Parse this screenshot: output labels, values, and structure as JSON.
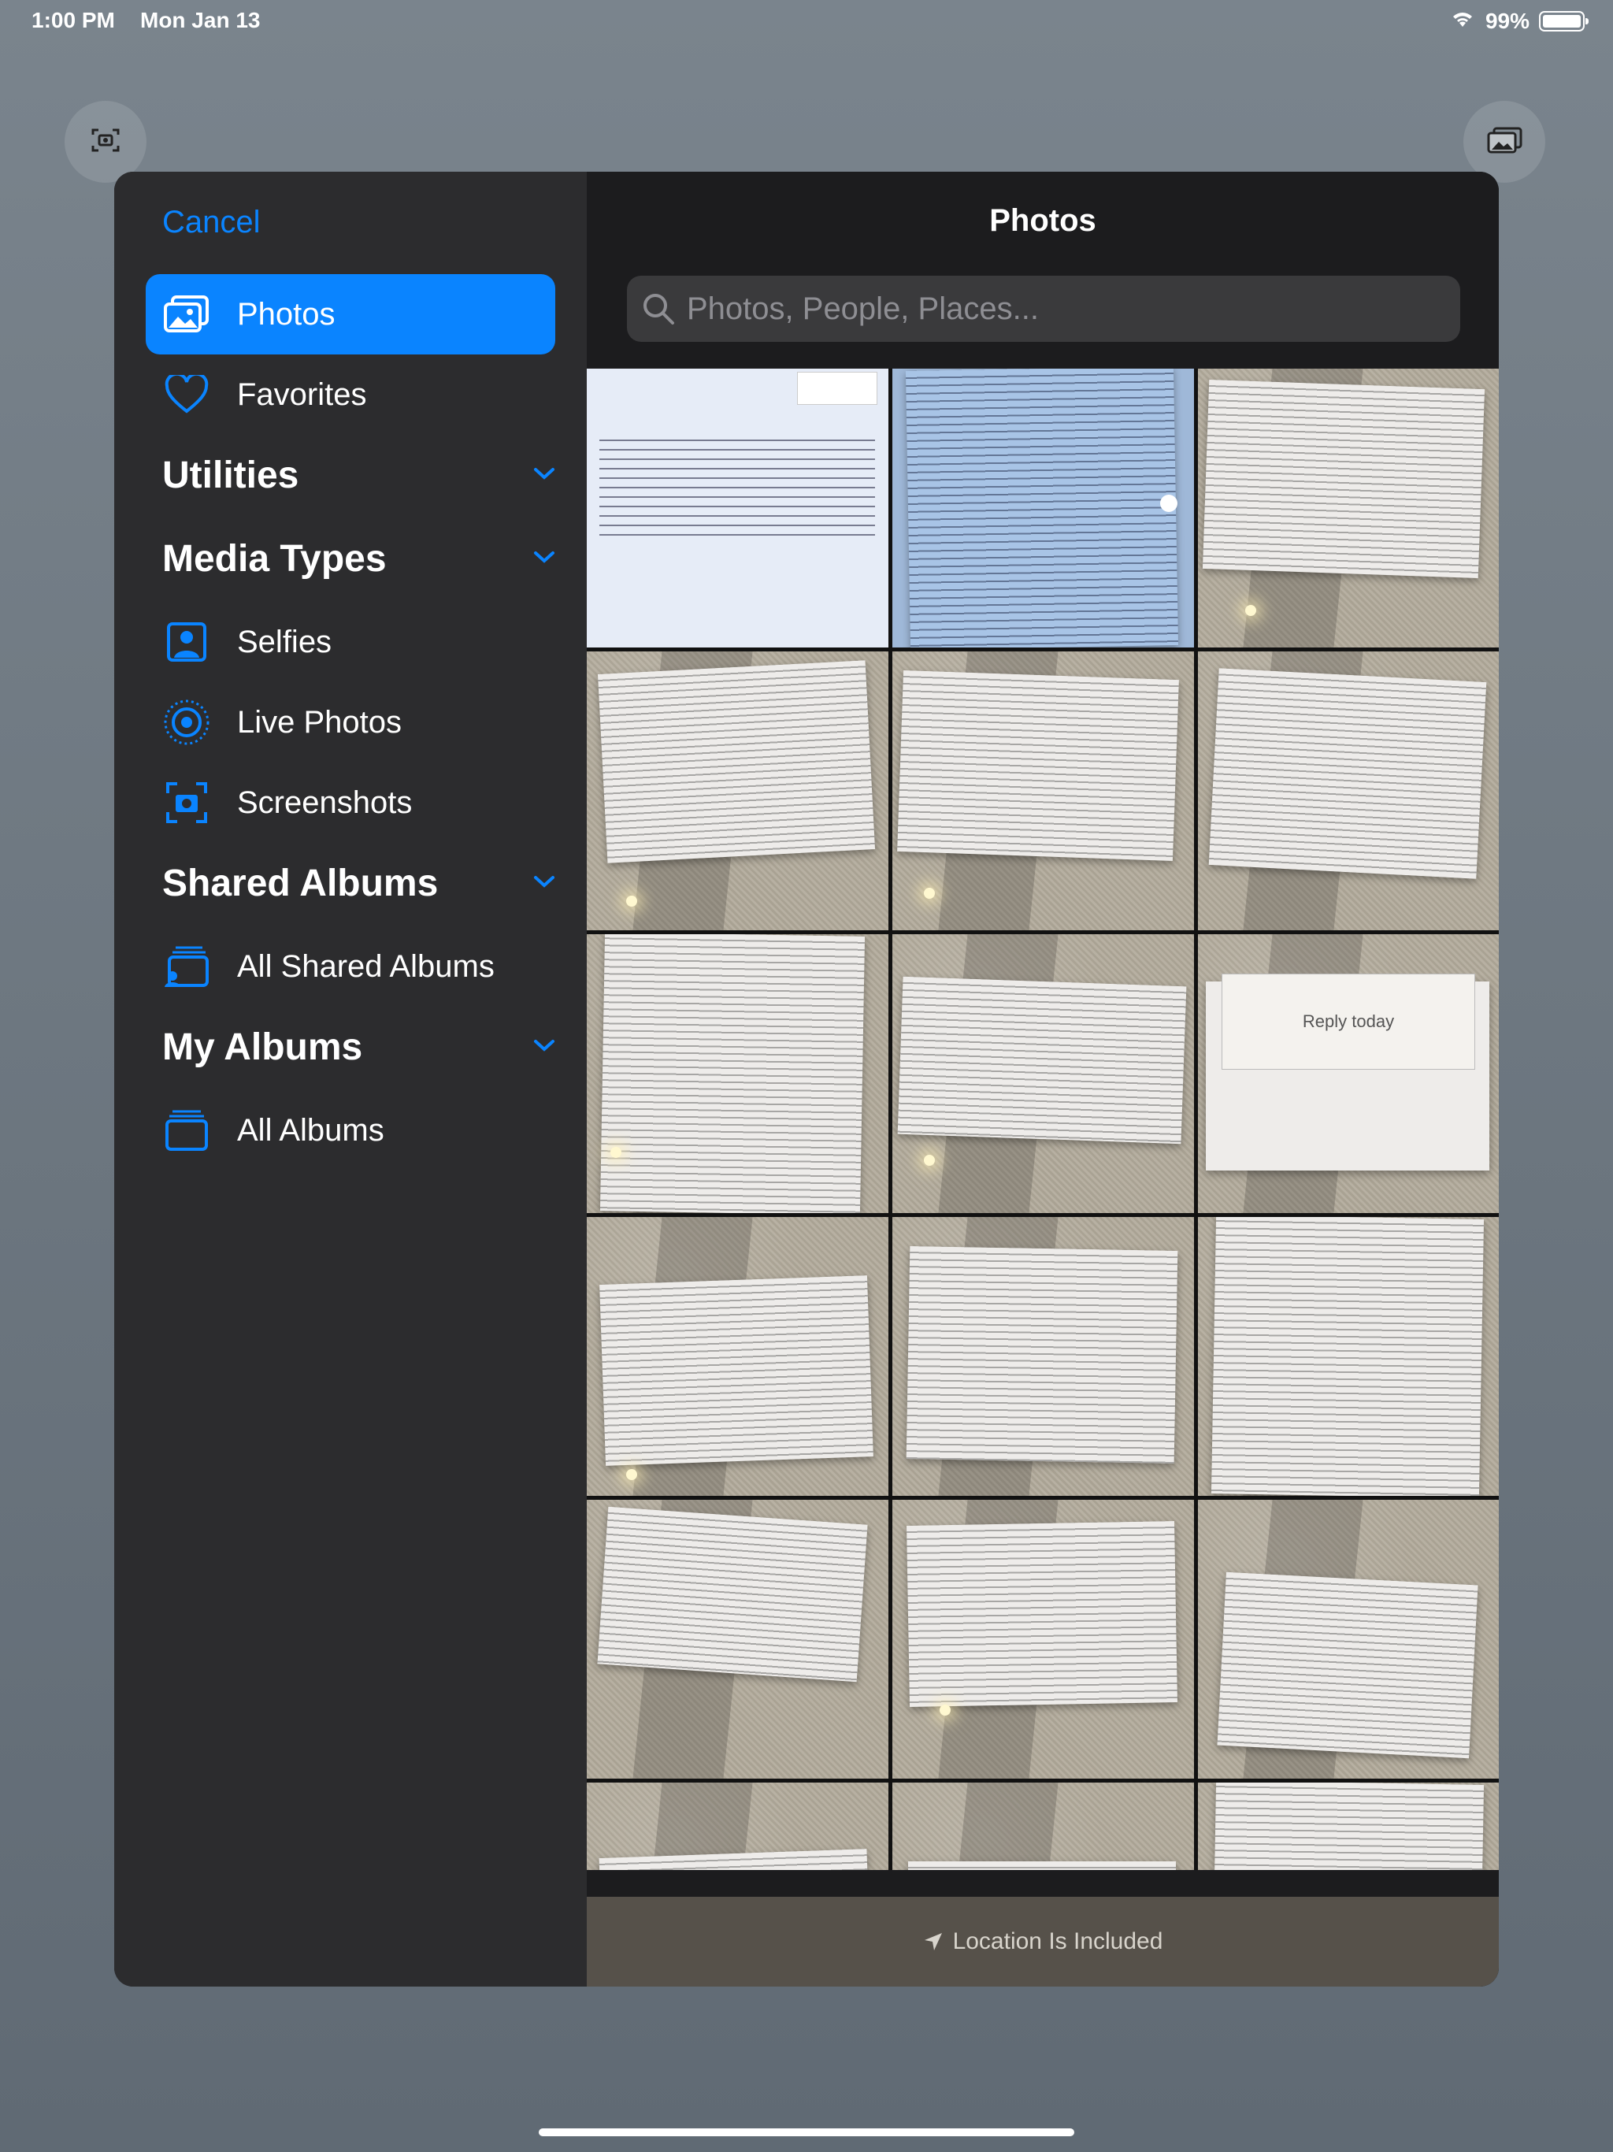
{
  "status_bar": {
    "time": "1:00 PM",
    "date": "Mon Jan 13",
    "battery": "99%",
    "battery_level": 0.99
  },
  "sidebar": {
    "cancel_label": "Cancel",
    "items_top": [
      {
        "label": "Photos",
        "icon": "photos-icon",
        "active": true
      },
      {
        "label": "Favorites",
        "icon": "heart-icon",
        "active": false
      }
    ],
    "sections": [
      {
        "title": "Utilities",
        "items": []
      },
      {
        "title": "Media Types",
        "items": [
          {
            "label": "Selfies",
            "icon": "selfie-icon"
          },
          {
            "label": "Live Photos",
            "icon": "live-photo-icon"
          },
          {
            "label": "Screenshots",
            "icon": "screenshot-icon"
          }
        ]
      },
      {
        "title": "Shared Albums",
        "items": [
          {
            "label": "All Shared Albums",
            "icon": "shared-albums-icon"
          }
        ]
      },
      {
        "title": "My Albums",
        "items": [
          {
            "label": "All Albums",
            "icon": "albums-icon"
          }
        ]
      }
    ]
  },
  "main": {
    "title": "Photos",
    "search_placeholder": "Photos, People, Places...",
    "grid_reply_text": "Reply today",
    "footer": "Location Is Included"
  },
  "colors": {
    "accent": "#0a84ff",
    "sidebar": "#2c2c2e",
    "main": "#1c1c1e"
  }
}
